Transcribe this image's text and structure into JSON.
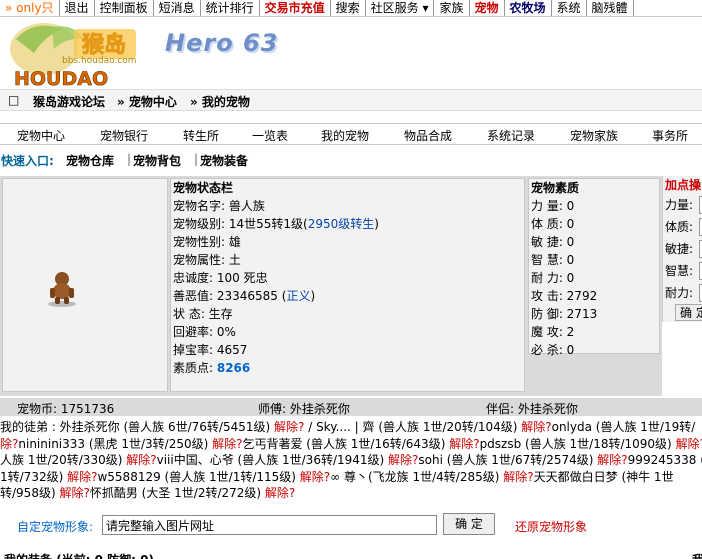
{
  "topnav": {
    "items": [
      "» only只",
      "退出",
      "控制面板",
      "短消息",
      "统计排行",
      "交易市充值",
      "搜索",
      "社区服务 ▾",
      "家族",
      "宠物",
      "农牧场",
      "系统",
      "脑残體"
    ]
  },
  "header": {
    "logo_text": "猴岛",
    "logo_sub": "HOUDAO",
    "logo_url": "bbs.houdao.com",
    "banner": "Hero 63"
  },
  "breadcrumb": [
    "猴岛游戏论坛",
    "» 宠物中心",
    "» 我的宠物"
  ],
  "petnav": [
    "宠物中心",
    "宠物银行",
    "转生所",
    "一览表",
    "我的宠物",
    "物品合成",
    "系统记录",
    "宠物家族",
    "事务所"
  ],
  "quick": {
    "label": "快速入口:",
    "items": [
      "宠物仓库",
      "宠物背包",
      "宠物装备"
    ]
  },
  "status": {
    "title": "宠物状态栏",
    "name": "宠物名字: 兽人族",
    "level_prefix": "宠物级别: 14世55转1级(",
    "level_link": "2950级转生",
    "level_suffix": ")",
    "gender": "宠物性别: 雄",
    "attribute": "宠物属性: 土",
    "loyalty": "忠诚度: 100 死忠",
    "karma_prefix": "善恶值: 23346585 (",
    "karma_link": "正义",
    "karma_suffix": ")",
    "state": "状    态: 生存",
    "evade": "回避率: 0%",
    "drop": "掉宝率: 4657",
    "points_label": "素质点: ",
    "points_value": "8266"
  },
  "quality": {
    "title": "宠物素质",
    "rows": [
      "力    量: 0",
      "体    质: 0",
      "敏    捷: 0",
      "智    慧: 0",
      "耐    力: 0",
      "攻    击: 2792",
      "防    御: 2713",
      "魔    攻: 2",
      "必    杀: 0"
    ]
  },
  "addpoints": {
    "title": "加点操",
    "rows": [
      "力量:",
      "体质:",
      "敏捷:",
      "智慧:",
      "耐力:"
    ],
    "confirm": "确 定"
  },
  "statbar": {
    "coins": "宠物币: 1751736",
    "master": "师傅: 外挂杀死你",
    "partner": "伴侣: 外挂杀死你"
  },
  "disciples": {
    "lines": [
      [
        [
          "我的徒弟 :  外挂杀死你 (兽人族 6世/76转/5451级) ",
          ""
        ],
        [
          "解除?",
          "r"
        ],
        [
          " / Sky.... | 齊 (兽人族 1世/20转/104级) ",
          ""
        ],
        [
          "解除?",
          "r"
        ],
        [
          "onlyda (兽人族 1世/19转/",
          ""
        ]
      ],
      [
        [
          "除?",
          "r"
        ],
        [
          "nininini333 (黑虎 1世/3转/250级) ",
          ""
        ],
        [
          "解除?",
          "r"
        ],
        [
          "乞丐背著爱 (兽人族 1世/16转/643级) ",
          ""
        ],
        [
          "解除?",
          "r"
        ],
        [
          "pdszsb (兽人族 1世/18转/1090级) ",
          ""
        ],
        [
          "解除?",
          "r"
        ],
        [
          "ly",
          ""
        ]
      ],
      [
        [
          "人族 1世/20转/330级) ",
          ""
        ],
        [
          "解除?",
          "r"
        ],
        [
          "viii中国、心爷 (兽人族 1世/36转/1941级) ",
          ""
        ],
        [
          "解除?",
          "r"
        ],
        [
          "sohi (兽人族 1世/67转/2574级) ",
          ""
        ],
        [
          "解除?",
          "r"
        ],
        [
          "999245338 (灵",
          ""
        ]
      ],
      [
        [
          "1转/732级) ",
          ""
        ],
        [
          "解除?",
          "r"
        ],
        [
          "w5588129 (兽人族 1世/1转/115级) ",
          ""
        ],
        [
          "解除?",
          "r"
        ],
        [
          "∞              尊丶(飞龙族 1世/4转/285级) ",
          ""
        ],
        [
          "解除?",
          "r"
        ],
        [
          "天天都做白日梦 (神牛 1世",
          ""
        ]
      ],
      [
        [
          "转/958级) ",
          ""
        ],
        [
          "解除?",
          "r"
        ],
        [
          "怀抓酷男 (大圣 1世/2转/272级) ",
          ""
        ],
        [
          "解除?",
          "r"
        ]
      ]
    ]
  },
  "custom": {
    "label": "自定宠物形象:",
    "input_value": "请完整输入图片网址",
    "confirm": "确 定",
    "restore": "还原宠物形象"
  },
  "bottom": {
    "left": "我的装备 (当前: 0 防御: 0)",
    "right": "我"
  }
}
